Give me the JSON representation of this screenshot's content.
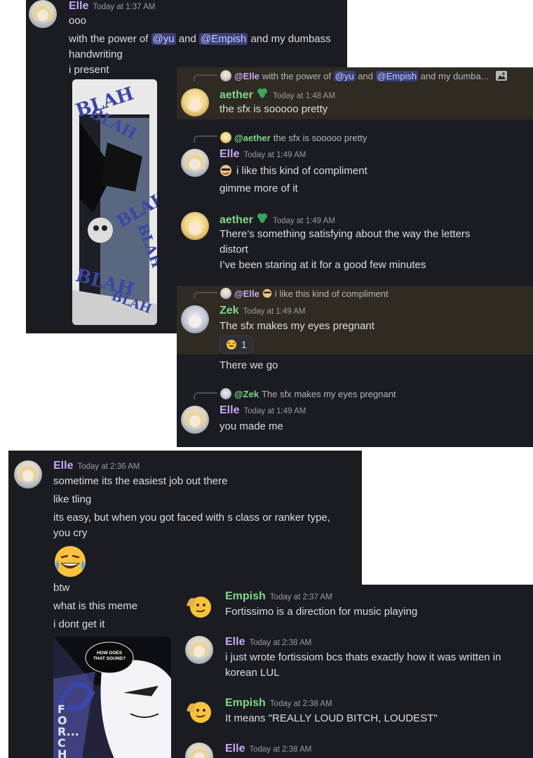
{
  "panel1": {
    "header": {
      "name": "Elle",
      "time": "Today at 1:37 AM"
    },
    "lines": [
      "ooo"
    ],
    "line_power": {
      "pre": "with the power of ",
      "m1": "@yu",
      "mid": " and ",
      "m2": "@Empish",
      "post": " and my dumbass"
    },
    "lines2": [
      "handwriting",
      "i present"
    ],
    "image_text": [
      "BLAH",
      "BLAH",
      "BLAH",
      "BLAH",
      "BLAH",
      "BLAH"
    ]
  },
  "panel2": {
    "reply1": {
      "name": "@Elle",
      "pre": " with the power of ",
      "m1": "@yu",
      "mid": " and ",
      "m2": "@Empish",
      "post": " and my dumba..."
    },
    "msg1": {
      "name": "aether",
      "time": "Today at 1:48 AM",
      "text": "the sfx is sooooo pretty"
    },
    "reply2": {
      "name": "@aether",
      "text": " the sfx is sooooo pretty"
    },
    "msg2": {
      "name": "Elle",
      "time": "Today at 1:49 AM",
      "text": "i like this kind of compliment",
      "text2": "gimme more of it"
    },
    "msg3": {
      "name": "aether",
      "time": "Today at 1:49 AM",
      "lines": [
        "There’s something satisfying about the way the letters",
        "distort",
        "I’ve been staring at it for a good few minutes"
      ]
    },
    "reply3": {
      "name": "@Elle",
      "text": "i like this kind of compliment"
    },
    "msg4": {
      "name": "Zek",
      "time": "Today at 1:49 AM",
      "text": "The sfx makes my eyes pregnant",
      "reaction_count": "1",
      "text2": "There we go"
    },
    "reply4": {
      "name": "@Zek",
      "text": " The sfx makes my eyes pregnant"
    },
    "msg5": {
      "name": "Elle",
      "time": "Today at 1:49 AM",
      "text": "you made me"
    }
  },
  "panel3": {
    "header": {
      "name": "Elle",
      "time": "Today at 2:36 AM"
    },
    "lines": [
      "sometime its the easiest job out there",
      "like tling",
      "its easy, but when you got faced with s class or ranker type,",
      "you cry"
    ],
    "lines2": [
      "btw",
      "what is this meme",
      "i dont get it"
    ],
    "image_bubble": [
      "HOW DOES",
      "THAT SOUND?"
    ],
    "image_vertical": "FOR...CHE"
  },
  "panel4": {
    "msg1": {
      "name": "Empish",
      "time": "Today at 2:37 AM",
      "text": "Fortissimo is a direction for music playing"
    },
    "msg2": {
      "name": "Elle",
      "time": "Today at 2:38 AM",
      "lines": [
        "i just wrote fortissiom bcs thats exactly how it was written in",
        "korean LUL"
      ]
    },
    "msg3": {
      "name": "Empish",
      "time": "Today at 2:38 AM",
      "text": "It means \"REALLY LOUD BITCH, LOUDEST\""
    },
    "msg4": {
      "name": "Elle",
      "time": "Today at 2:38 AM"
    }
  },
  "colors": {
    "bg": "#1b1c22",
    "elle": "#c9a9f5",
    "green": "#7fd88a",
    "mention_bg": "#3b3f7a",
    "highlight": "#2f2a22"
  }
}
